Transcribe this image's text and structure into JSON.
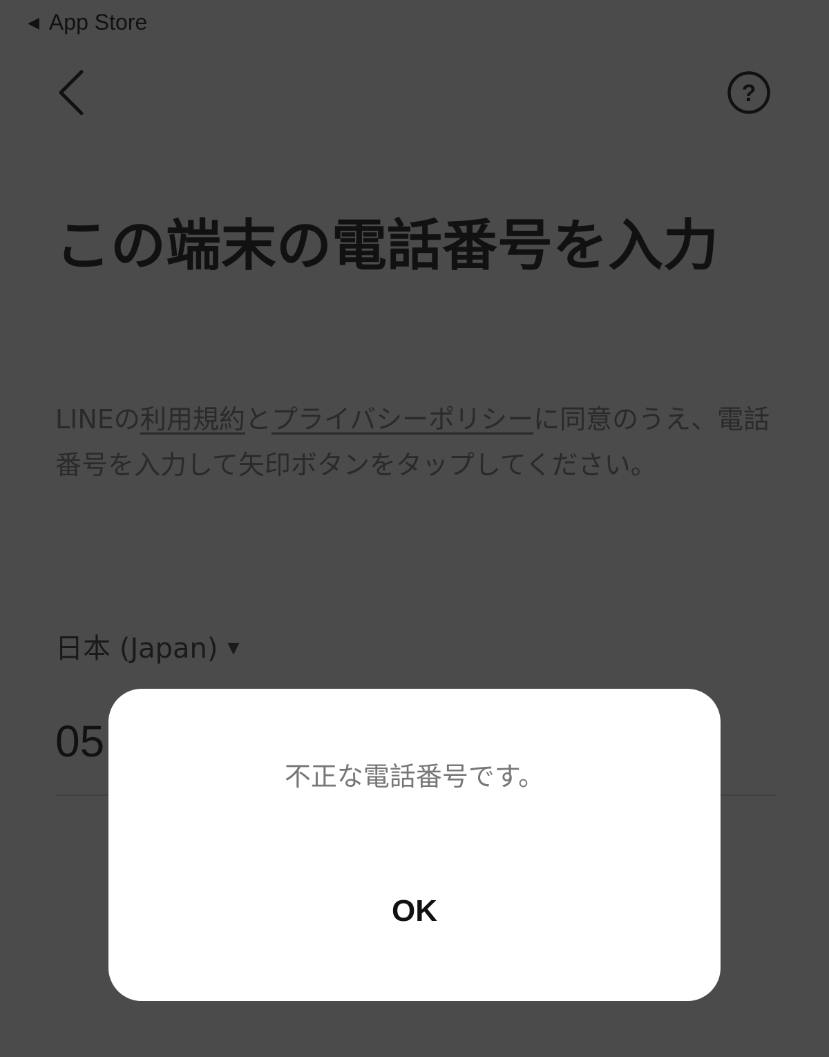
{
  "status_bar": {
    "back_indicator": "◀",
    "back_label": "App Store"
  },
  "nav": {
    "back_icon": "chevron-left-icon",
    "help_icon": "question-circle-icon"
  },
  "title": "この端末の電話番号を入力",
  "description": {
    "part1": "LINEの",
    "link_terms": "利用規約",
    "part2": "と",
    "link_privacy": "プライバシーポリシー",
    "part3": "に同意のうえ、電話番号を入力して矢印ボタンをタップしてください。"
  },
  "country_selector": {
    "label": "日本 (Japan)",
    "caret": "▼"
  },
  "phone_input": {
    "value": "05"
  },
  "dialog": {
    "message": "不正な電話番号です。",
    "ok_label": "OK"
  },
  "colors": {
    "dimmed_background": "#4b4b4b",
    "dialog_background": "#ffffff"
  }
}
